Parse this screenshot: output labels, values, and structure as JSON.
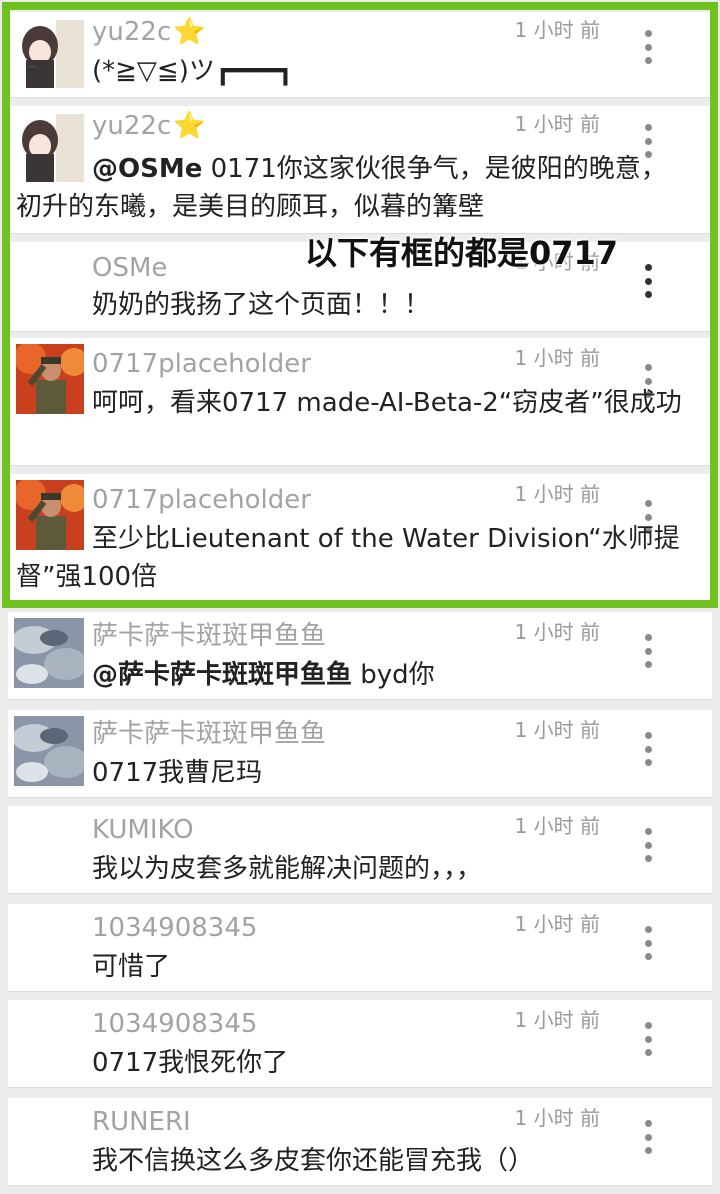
{
  "annotation": "以下有框的都是0717",
  "comments": [
    {
      "user": "yu22c",
      "star": "⭐",
      "time": "1 小时 前",
      "mention": "",
      "text": "(*≧▽≦)ツ┏━━━┓",
      "avatar": "anime-girl"
    },
    {
      "user": "yu22c",
      "star": "⭐",
      "time": "1 小时 前",
      "mention": "@OSMe",
      "text": " 0171你这家伙很争气，是彼阳的晚意，初升的东曦，是美目的顾耳，似暮的篝壁",
      "avatar": "anime-girl"
    },
    {
      "user": "OSMe",
      "star": "",
      "time": "1 小时 前",
      "mention": "",
      "text": "奶奶的我扬了这个页面！！！",
      "avatar": "none"
    },
    {
      "user": "0717placeholder",
      "star": "",
      "time": "1 小时 前",
      "mention": "",
      "text": "呵呵，看来0717 made-AI-Beta-2“窃皮者”很成功",
      "avatar": "soldier"
    },
    {
      "user": "0717placeholder",
      "star": "",
      "time": "1 小时 前",
      "mention": "",
      "text": "至少比Lieutenant of the Water Division“水师提督”强100倍",
      "avatar": "soldier"
    },
    {
      "user": "萨卡萨卡斑斑甲鱼鱼",
      "star": "",
      "time": "1 小时 前",
      "mention": "@萨卡萨卡斑斑甲鱼鱼",
      "text": " byd你",
      "avatar": "clouds"
    },
    {
      "user": "萨卡萨卡斑斑甲鱼鱼",
      "star": "",
      "time": "1 小时 前",
      "mention": "",
      "text": "0717我曹尼玛",
      "avatar": "clouds"
    },
    {
      "user": "KUMIKO",
      "star": "",
      "time": "1 小时 前",
      "mention": "",
      "text": "我以为皮套多就能解决问题的，，，",
      "avatar": "none"
    },
    {
      "user": "1034908345",
      "star": "",
      "time": "1 小时 前",
      "mention": "",
      "text": "可惜了",
      "avatar": "none"
    },
    {
      "user": "1034908345",
      "star": "",
      "time": "1 小时 前",
      "mention": "",
      "text": "0717我恨死你了",
      "avatar": "none"
    },
    {
      "user": "RUNERI",
      "star": "",
      "time": "1 小时 前",
      "mention": "",
      "text": "我不信换这么多皮套你还能冒充我（）",
      "avatar": "none"
    }
  ],
  "colors": {
    "frame": "#6fc11f",
    "username": "#a3a3a3",
    "star": "#f6b200"
  }
}
